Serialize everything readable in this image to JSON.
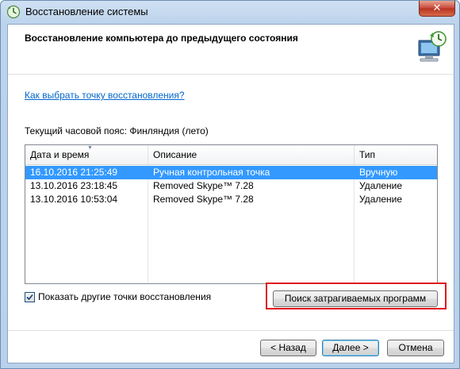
{
  "window": {
    "title": "Восстановление системы",
    "close_label": "✕"
  },
  "header": {
    "heading": "Восстановление компьютера до предыдущего состояния"
  },
  "help_link": "Как выбрать точку восстановления?",
  "timezone_label": "Текущий часовой пояс: Финляндия (лето)",
  "table": {
    "columns": [
      "Дата и время",
      "Описание",
      "Тип"
    ],
    "rows": [
      {
        "date": "16.10.2016 21:25:49",
        "description": "Ручная контрольная точка",
        "type": "Вручную",
        "selected": true
      },
      {
        "date": "13.10.2016 23:18:45",
        "description": "Removed Skype™ 7.28",
        "type": "Удаление",
        "selected": false
      },
      {
        "date": "13.10.2016 10:53:04",
        "description": "Removed Skype™ 7.28",
        "type": "Удаление",
        "selected": false
      }
    ]
  },
  "show_more": {
    "label": "Показать другие точки восстановления",
    "checked": true
  },
  "buttons": {
    "search": "Поиск затрагиваемых программ",
    "back": "< Назад",
    "next": "Далее >",
    "cancel": "Отмена"
  },
  "colors": {
    "selection": "#3399ff",
    "link": "#0066cc",
    "highlight": "#e01818"
  }
}
